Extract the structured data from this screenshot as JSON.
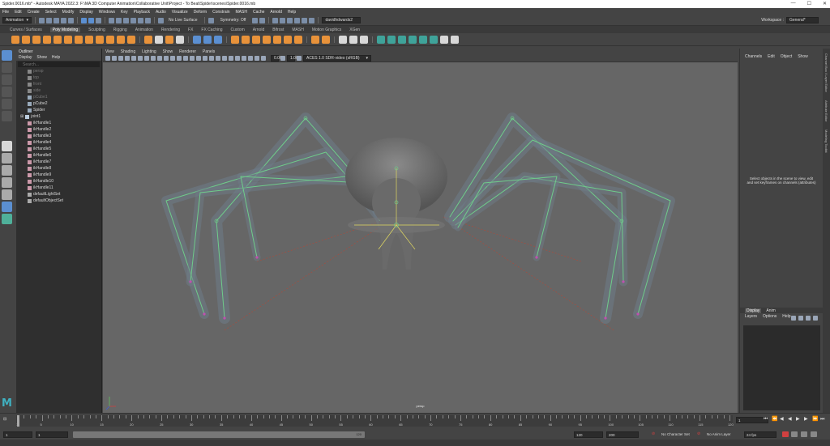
{
  "window": {
    "title": "Spider.0016.mb* - Autodesk MAYA 2022.3: F:\\MA 3D Computer Animation\\Collaborative Unit\\Project - To Beat\\Spider\\scenes\\Spider.0016.mb",
    "minimize": "—",
    "maximize": "☐",
    "close": "✕"
  },
  "menubar": [
    "File",
    "Edit",
    "Create",
    "Select",
    "Modify",
    "Display",
    "Windows",
    "Key",
    "Playback",
    "Audio",
    "Visualize",
    "Deform",
    "Constrain",
    "MASH",
    "Cache",
    "Arnold",
    "Help"
  ],
  "statusline": {
    "menuset": "Animation",
    "live_surface": "No Live Surface",
    "symmetry": "Symmetry: Off",
    "user": "davidhdwards2",
    "workspace_label": "Workspace :",
    "workspace_value": "General*"
  },
  "shelf_tabs": [
    "Curves / Surfaces",
    "Poly Modeling",
    "Sculpting",
    "Rigging",
    "Animation",
    "Rendering",
    "FX",
    "FX Caching",
    "Custom",
    "Arnold",
    "Bifrost",
    "MASH",
    "Motion Graphics",
    "XGen"
  ],
  "shelf_active_tab": "Poly Modeling",
  "shelf_colors": {
    "orange": "#e8923a",
    "blue": "#5b8fd1",
    "green": "#4fb09a",
    "white": "#d8d8d8",
    "teal": "#3fa39a"
  },
  "outliner": {
    "title": "Outliner",
    "menu": [
      "Display",
      "Show",
      "Help"
    ],
    "search_placeholder": "Search...",
    "items": [
      {
        "label": "persp",
        "dim": true,
        "icon": "camera-icon"
      },
      {
        "label": "top",
        "dim": true,
        "icon": "camera-icon"
      },
      {
        "label": "front",
        "dim": true,
        "icon": "camera-icon"
      },
      {
        "label": "side",
        "dim": true,
        "icon": "camera-icon"
      },
      {
        "label": "pCube1",
        "dim": true,
        "icon": "mesh-icon"
      },
      {
        "label": "pCube2",
        "dim": false,
        "icon": "mesh-icon"
      },
      {
        "label": "Spider",
        "dim": false,
        "icon": "mesh-icon"
      },
      {
        "label": "joint1",
        "dim": false,
        "icon": "joint-icon",
        "expand": "⊞"
      },
      {
        "label": "ikHandle1",
        "dim": false,
        "icon": "ik-handle-icon"
      },
      {
        "label": "ikHandle2",
        "dim": false,
        "icon": "ik-handle-icon"
      },
      {
        "label": "ikHandle3",
        "dim": false,
        "icon": "ik-handle-icon"
      },
      {
        "label": "ikHandle4",
        "dim": false,
        "icon": "ik-handle-icon"
      },
      {
        "label": "ikHandle5",
        "dim": false,
        "icon": "ik-handle-icon"
      },
      {
        "label": "ikHandle6",
        "dim": false,
        "icon": "ik-handle-icon"
      },
      {
        "label": "ikHandle7",
        "dim": false,
        "icon": "ik-handle-icon"
      },
      {
        "label": "ikHandle8",
        "dim": false,
        "icon": "ik-handle-icon"
      },
      {
        "label": "ikHandle9",
        "dim": false,
        "icon": "ik-handle-icon"
      },
      {
        "label": "ikHandle10",
        "dim": false,
        "icon": "ik-handle-icon"
      },
      {
        "label": "ikHandle11",
        "dim": false,
        "icon": "ik-handle-icon"
      },
      {
        "label": "defaultLightSet",
        "dim": false,
        "icon": "set-icon"
      },
      {
        "label": "defaultObjectSet",
        "dim": false,
        "icon": "set-icon"
      }
    ]
  },
  "viewport": {
    "menu": [
      "View",
      "Shading",
      "Lighting",
      "Show",
      "Renderer",
      "Panels"
    ],
    "exposure": "0.00",
    "gamma": "1.00",
    "colorspace": "ACES 1.0 SDR-video (sRGB)",
    "camera_label": "persp"
  },
  "channelbox": {
    "menu": [
      "Channels",
      "Edit",
      "Object",
      "Show"
    ],
    "message": "Select objects in the scene to view, edit and set keyframes on channels (attributes)"
  },
  "layers": {
    "tabs": [
      "Display",
      "Anim"
    ],
    "active_tab": "Display",
    "menu": [
      "Layers",
      "Options",
      "Help"
    ]
  },
  "side_tabs": [
    "Channel Box / Layer Editor",
    "Attribute Editor",
    "Modeling Toolkit"
  ],
  "timeline": {
    "ticks": [
      "1",
      "5",
      "10",
      "15",
      "20",
      "25",
      "30",
      "35",
      "40",
      "45",
      "50",
      "55",
      "60",
      "65",
      "70",
      "75",
      "80",
      "85",
      "90",
      "95",
      "100",
      "105",
      "110",
      "115",
      "120"
    ],
    "current_frame": "1"
  },
  "range": {
    "start": "1",
    "start_inner": "1",
    "range_end_label": "120",
    "end_inner": "120",
    "end": "200",
    "character_set": "No Character Set",
    "anim_layer": "No Anim Layer",
    "fps": "24 fps"
  }
}
